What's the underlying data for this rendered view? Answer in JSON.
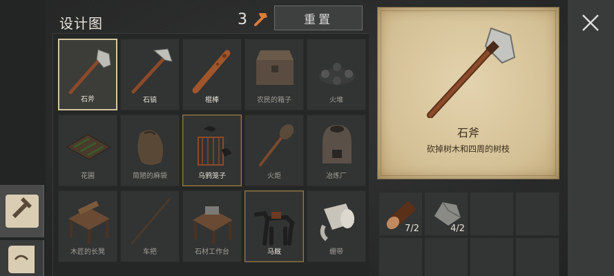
{
  "header": {
    "title": "设计图",
    "count": "3"
  },
  "reset_label": "重置",
  "blueprints": [
    {
      "label": "石斧",
      "state": "selected"
    },
    {
      "label": "石镐",
      "state": "normal"
    },
    {
      "label": "棍棒",
      "state": "normal"
    },
    {
      "label": "农民的箱子",
      "state": "dim"
    },
    {
      "label": "火堆",
      "state": "dim"
    },
    {
      "label": "花圃",
      "state": "dim"
    },
    {
      "label": "简陋的麻袋",
      "state": "dim"
    },
    {
      "label": "乌鸦笼子",
      "state": "gold"
    },
    {
      "label": "火炬",
      "state": "dim"
    },
    {
      "label": "冶炼厂",
      "state": "dim"
    },
    {
      "label": "木匠的长凳",
      "state": "dim"
    },
    {
      "label": "车把",
      "state": "dim"
    },
    {
      "label": "石材工作台",
      "state": "dim"
    },
    {
      "label": "马厩",
      "state": "gold"
    },
    {
      "label": "绷带",
      "state": "dim"
    }
  ],
  "detail": {
    "name": "石斧",
    "description": "砍掉树木和四周的树枝"
  },
  "resources": [
    {
      "icon": "log-icon",
      "qty": "7/2"
    },
    {
      "icon": "stone-icon",
      "qty": "4/2"
    }
  ],
  "colors": {
    "parchment": "#d9c79f",
    "accent_gold": "#8f7a4a",
    "hammer": "#d97c3a"
  }
}
